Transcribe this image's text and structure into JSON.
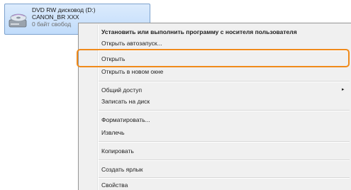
{
  "drive": {
    "line1": "DVD RW дисковод (D:)",
    "line2": "CANON_BR XXX",
    "line3": "0 байт свобод",
    "icon": "optical-drive-icon"
  },
  "menu": {
    "items": [
      {
        "label": "Установить или выполнить программу с носителя пользователя",
        "bold": true
      },
      {
        "label": "Открыть автозапуск..."
      },
      {
        "label": "Открыть"
      },
      {
        "label": "Открыть в новом окне"
      },
      {
        "label": "Общий доступ"
      },
      {
        "label": "Записать на диск"
      },
      {
        "label": "Форматировать..."
      },
      {
        "label": "Извлечь"
      },
      {
        "label": "Копировать"
      },
      {
        "label": "Создать ярлык"
      },
      {
        "label": "Свойства"
      }
    ],
    "submenu_arrow": "▸"
  },
  "colors": {
    "highlight": "#f08a1a",
    "selection": "#c1dcfb"
  }
}
